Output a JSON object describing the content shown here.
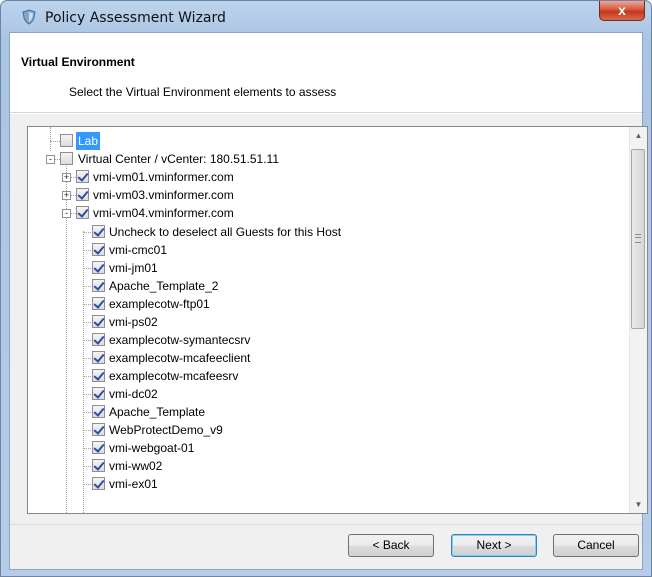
{
  "window": {
    "title": "Policy Assessment Wizard",
    "close_glyph": "x",
    "icon": "shield-icon"
  },
  "header": {
    "title": "Virtual Environment",
    "subtitle": "Select the Virtual Environment elements to assess"
  },
  "tree": {
    "items": [
      {
        "label": "Lab",
        "checked": false,
        "selected": true
      },
      {
        "label": "Virtual Center / vCenter: 180.51.51.11",
        "checked": false,
        "expander": "-"
      },
      {
        "label": "vmi-vm01.vminformer.com",
        "checked": true,
        "expander": "+"
      },
      {
        "label": "vmi-vm03.vminformer.com",
        "checked": true,
        "expander": "+"
      },
      {
        "label": "vmi-vm04.vminformer.com",
        "checked": true,
        "expander": "-"
      },
      {
        "label": "Uncheck to deselect all Guests for this Host",
        "checked": true
      },
      {
        "label": "vmi-cmc01",
        "checked": true
      },
      {
        "label": "vmi-jm01",
        "checked": true
      },
      {
        "label": "Apache_Template_2",
        "checked": true
      },
      {
        "label": "examplecotw-ftp01",
        "checked": true
      },
      {
        "label": "vmi-ps02",
        "checked": true
      },
      {
        "label": "examplecotw-symantecsrv",
        "checked": true
      },
      {
        "label": "examplecotw-mcafeeclient",
        "checked": true
      },
      {
        "label": "examplecotw-mcafeesrv",
        "checked": true
      },
      {
        "label": "vmi-dc02",
        "checked": true
      },
      {
        "label": "Apache_Template",
        "checked": true
      },
      {
        "label": "WebProtectDemo_v9",
        "checked": true
      },
      {
        "label": "vmi-webgoat-01",
        "checked": true
      },
      {
        "label": "vmi-ww02",
        "checked": true
      },
      {
        "label": "vmi-ex01",
        "checked": true
      }
    ]
  },
  "scrollbar": {
    "up_glyph": "▲",
    "down_glyph": "▼"
  },
  "buttons": {
    "back": "< Back",
    "next": "Next >",
    "cancel": "Cancel"
  },
  "colors": {
    "selection": "#3399ff",
    "check": "#2a4fa8"
  }
}
